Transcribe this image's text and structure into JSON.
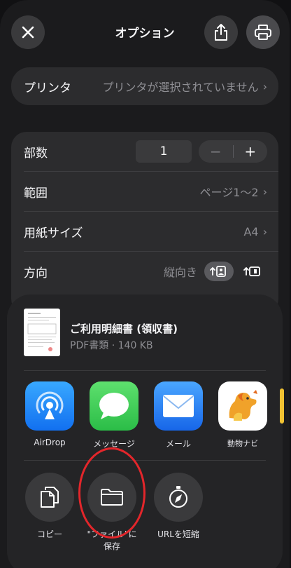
{
  "header": {
    "title": "オプション"
  },
  "printer": {
    "label": "プリンタ",
    "value": "プリンタが選択されていません"
  },
  "options": {
    "copies": {
      "label": "部数",
      "value": "1",
      "minus": "−",
      "plus": "+"
    },
    "range": {
      "label": "範囲",
      "value": "ページ1〜2"
    },
    "paper": {
      "label": "用紙サイズ",
      "value": "A4"
    },
    "orientation": {
      "label": "方向",
      "value": "縦向き"
    }
  },
  "share": {
    "document": {
      "title": "ご利用明細書 (領収書)",
      "meta": "PDF書類 · 140 KB"
    },
    "apps": [
      {
        "label": "AirDrop"
      },
      {
        "label": "メッセージ"
      },
      {
        "label": "メール"
      },
      {
        "label": "動物ナビ"
      }
    ],
    "actions": [
      {
        "label": "コピー"
      },
      {
        "label_line1": "\"ファイル\"に",
        "label_line2": "保存"
      },
      {
        "label": "URLを短縮"
      }
    ]
  },
  "colors": {
    "accent_red": "#e3262b",
    "airdrop_blue": "#1a8cff",
    "messages_green": "#34c759",
    "mail_blue": "#2f8cff"
  }
}
